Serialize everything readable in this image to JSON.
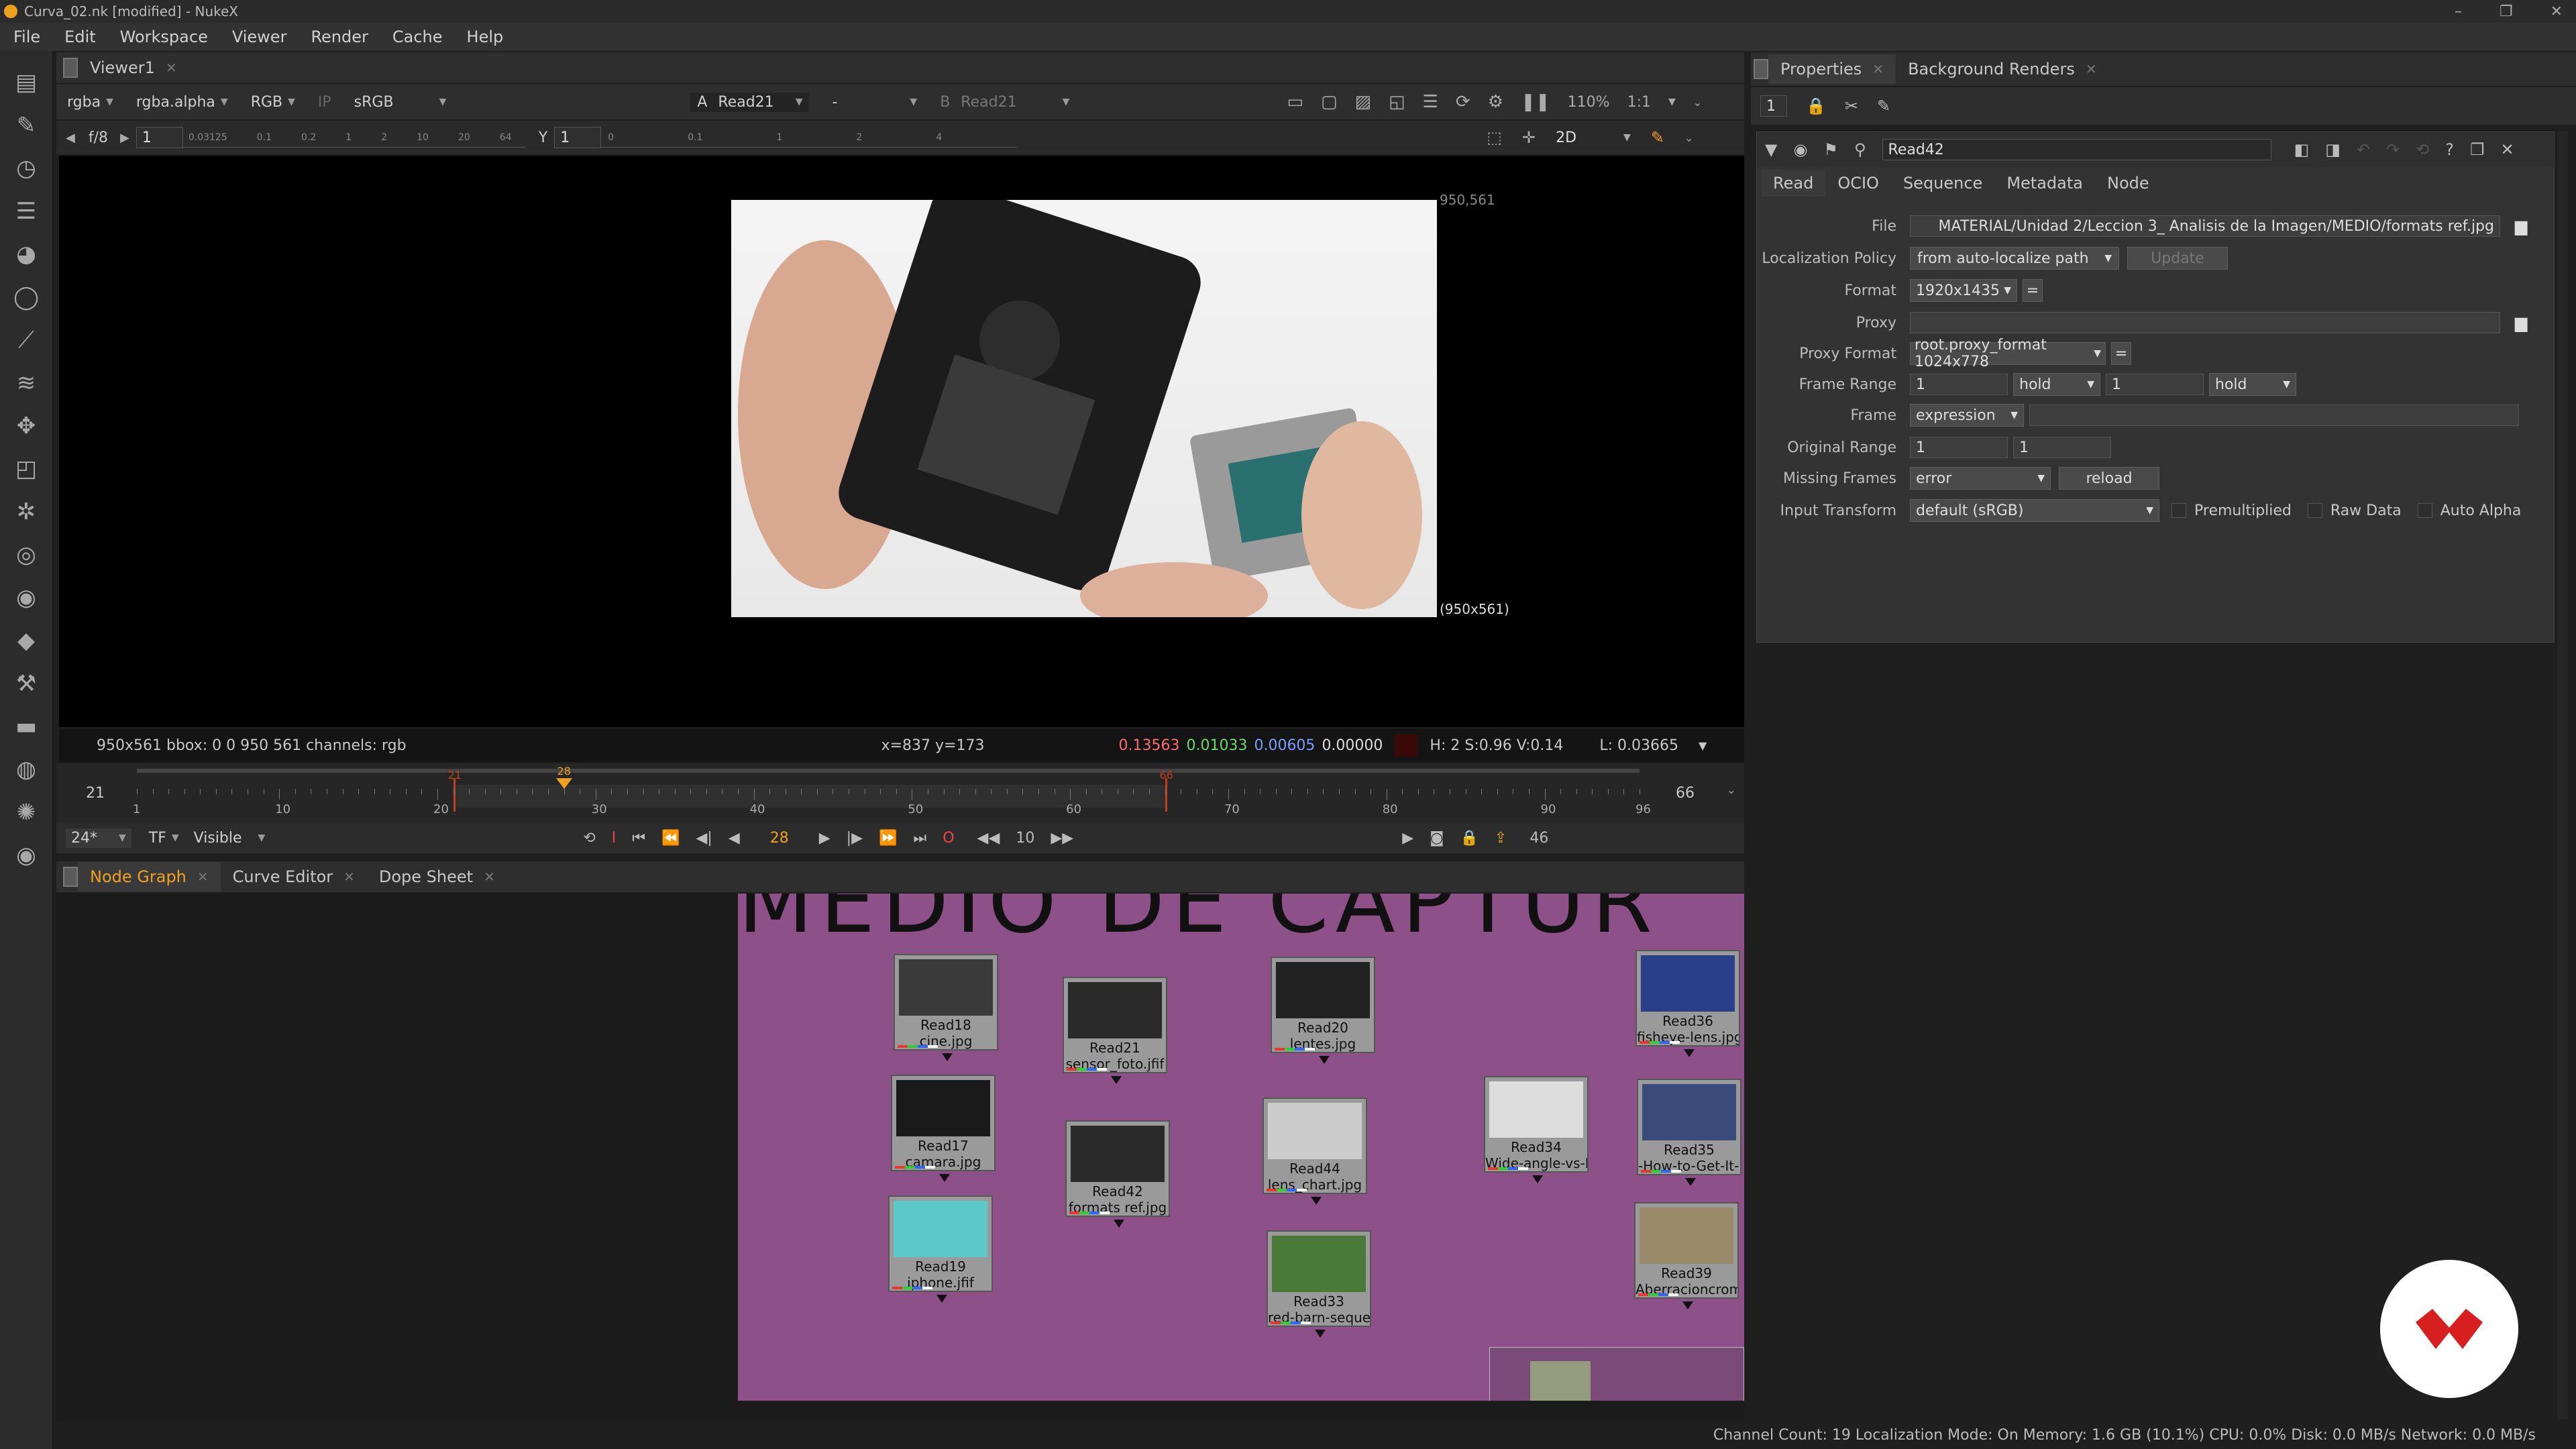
{
  "window": {
    "title": "Curva_02.nk [modified] - NukeX"
  },
  "menu": [
    "File",
    "Edit",
    "Workspace",
    "Viewer",
    "Render",
    "Cache",
    "Help"
  ],
  "viewer": {
    "tab": "Viewer1",
    "channels": "rgba",
    "alpha": "rgba.alpha",
    "display_channels": "RGB",
    "ip": "IP",
    "lut": "sRGB",
    "input_a_label": "A",
    "input_a": "Read21",
    "blend": "-",
    "input_b_label": "B",
    "input_b": "Read21",
    "zoom": "110%",
    "ratio": "1:1",
    "fstop": "f/8",
    "gain": "1",
    "gamma_label": "Y",
    "gamma": "1",
    "view_mode": "2D",
    "gain_ticks": [
      "0.03125",
      "0.1",
      "0.2",
      "1",
      "2",
      "10",
      "20",
      "64"
    ],
    "gamma_ticks": [
      "0",
      "0.1",
      "1",
      "2",
      "4"
    ],
    "format_corner": "950,561",
    "format_label": "(950x561)",
    "info_left": "950x561  bbox: 0 0 950 561 channels: rgb",
    "cursor": "x=837 y=173",
    "pixel_r": "0.13563",
    "pixel_g": "0.01033",
    "pixel_b": "0.00605",
    "pixel_a": "0.00000",
    "hsv": "H:  2 S:0.96 V:0.14",
    "luma": "L: 0.03665"
  },
  "timeline": {
    "in_frame": "21",
    "out_frame": "66",
    "current": 28,
    "range_start": 1,
    "range_end": 96,
    "in_mark": 21,
    "out_mark": 66,
    "ticks": [
      "1",
      "10",
      "20",
      "30",
      "40",
      "50",
      "60",
      "70",
      "80",
      "90",
      "96"
    ],
    "fps": "24*",
    "tf": "TF",
    "visibility": "Visible",
    "current_label": "28",
    "skip": "10",
    "end_frame": "46"
  },
  "node_graph": {
    "tabs": [
      "Node Graph",
      "Curve Editor",
      "Dope Sheet"
    ],
    "backdrop_title": "MEDIO DE CAPTUR",
    "nodes": [
      {
        "name": "Read18",
        "file": "cine.jpg",
        "thumb": "#3a3a3a"
      },
      {
        "name": "Read21",
        "file": "sensor_foto.jfif",
        "thumb": "#2a2a2a"
      },
      {
        "name": "Read20",
        "file": "lentes.jpg",
        "thumb": "#222"
      },
      {
        "name": "Read36",
        "file": "fisheye-lens.jpg",
        "thumb": "#2a3f8a"
      },
      {
        "name": "Read17",
        "file": "camara.jpg",
        "thumb": "#1a1a1a"
      },
      {
        "name": "Read42",
        "file": "formats ref.jpg",
        "thumb": "#2a2a2a"
      },
      {
        "name": "Read44",
        "file": "lens_chart.jpg",
        "thumb": "#cccccc"
      },
      {
        "name": "Read34",
        "file": "Wide-angle-vs-Fisheye",
        "thumb": "#dddddd"
      },
      {
        "name": "Read35",
        "file": "-How-to-Get-It-How-",
        "thumb": "#3a4a7a"
      },
      {
        "name": "Read19",
        "file": "iphone.jfif",
        "thumb": "#5cc8c8"
      },
      {
        "name": "Read33",
        "file": "red-barn-sequence.jpg",
        "thumb": "#4a7a3a"
      },
      {
        "name": "Read39",
        "file": "Aberracioncromatica",
        "thumb": "#9a8a6a"
      }
    ]
  },
  "properties": {
    "tabs": [
      "Properties",
      "Background Renders"
    ],
    "max_panels": "1",
    "node_name": "Read42",
    "sub_tabs": [
      "Read",
      "OCIO",
      "Sequence",
      "Metadata",
      "Node"
    ],
    "file_label": "File",
    "file": "MATERIAL/Unidad 2/Leccion 3_ Analisis de la Imagen/MEDIO/formats ref.jpg",
    "localization_label": "Localization Policy",
    "localization": "from auto-localize path",
    "update_btn": "Update",
    "format_label": "Format",
    "format": "1920x1435",
    "proxy_label": "Proxy",
    "proxy": "",
    "proxy_format_label": "Proxy Format",
    "proxy_format": "root.proxy_format 1024x778",
    "frame_range_label": "Frame Range",
    "frame_start": "1",
    "before": "hold",
    "frame_end": "1",
    "after": "hold",
    "frame_label": "Frame",
    "frame_mode": "expression",
    "original_range_label": "Original Range",
    "orig_start": "1",
    "orig_end": "1",
    "missing_label": "Missing Frames",
    "missing": "error",
    "reload_btn": "reload",
    "input_transform_label": "Input Transform",
    "input_transform": "default (sRGB)",
    "premult_label": "Premultiplied",
    "raw_label": "Raw Data",
    "auto_alpha_label": "Auto Alpha"
  },
  "status": "Channel Count: 19  Localization Mode: On  Memory: 1.6 GB (10.1%)  CPU: 0.0%  Disk: 0.0 MB/s  Network: 0.0 MB/s",
  "colors": {
    "accent": "#f0a020",
    "in_out": "#c04020",
    "backdrop": "#8e5088",
    "logo_red": "#d81f1f"
  }
}
